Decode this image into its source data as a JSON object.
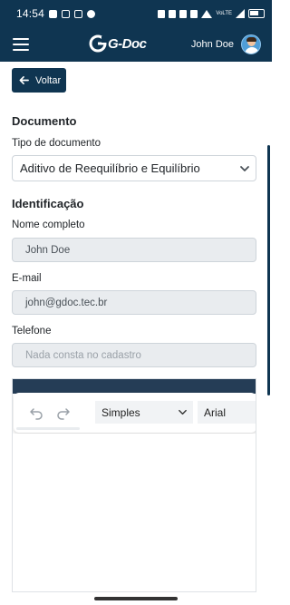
{
  "status": {
    "time": "14:54",
    "network": "VoLTE"
  },
  "navbar": {
    "logo_text": "G-Doc",
    "user_name": "John Doe"
  },
  "form": {
    "back_label": "Voltar",
    "document_section": "Documento",
    "doc_type_label": "Tipo de documento",
    "doc_type_value": "Aditivo de Reequilíbrio e Equilíbrio",
    "identification_section": "Identificação",
    "name_label": "Nome completo",
    "name_value": "John Doe",
    "email_label": "E-mail",
    "email_value": "john@gdoc.tec.br",
    "phone_label": "Telefone",
    "phone_placeholder": "Nada consta no cadastro"
  },
  "editor": {
    "format_value": "Simples",
    "font_value": "Arial"
  },
  "colors": {
    "primary": "#0f3551",
    "input_disabled_bg": "#e9ecef"
  }
}
